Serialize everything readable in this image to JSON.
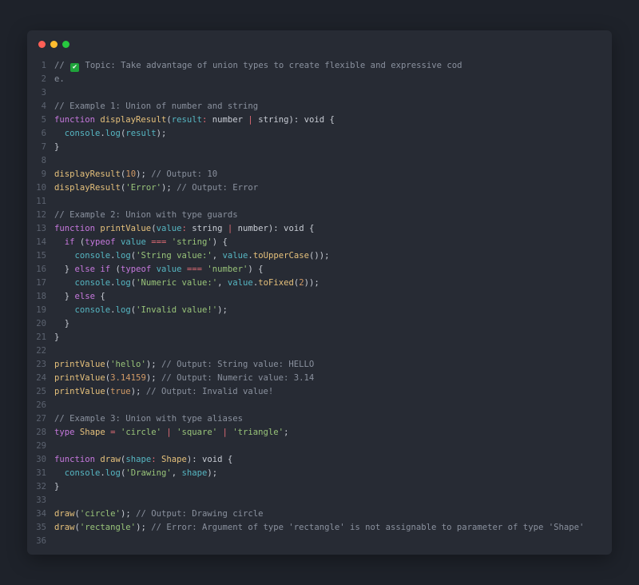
{
  "window": {
    "controls": [
      {
        "name": "close",
        "color": "#ff5f56"
      },
      {
        "name": "minimize",
        "color": "#ffbd2e"
      },
      {
        "name": "maximize",
        "color": "#27c93f"
      }
    ]
  },
  "code": {
    "lines": [
      {
        "n": "1",
        "tokens": [
          {
            "c": "comment",
            "t": "// "
          },
          {
            "c": "icon",
            "t": "check-icon"
          },
          {
            "c": "comment",
            "t": " Topic: Take advantage of union types to create flexible and expressive cod"
          }
        ]
      },
      {
        "n": "2",
        "tokens": [
          {
            "c": "comment",
            "t": "e."
          }
        ]
      },
      {
        "n": "3",
        "tokens": []
      },
      {
        "n": "4",
        "tokens": [
          {
            "c": "comment",
            "t": "// Example 1: Union of number and string"
          }
        ]
      },
      {
        "n": "5",
        "tokens": [
          {
            "c": "keyword",
            "t": "function "
          },
          {
            "c": "func",
            "t": "displayResult"
          },
          {
            "c": "plain",
            "t": "("
          },
          {
            "c": "param",
            "t": "result"
          },
          {
            "c": "op",
            "t": ": "
          },
          {
            "c": "plain",
            "t": "number "
          },
          {
            "c": "op",
            "t": "|"
          },
          {
            "c": "plain",
            "t": " string): void {"
          }
        ]
      },
      {
        "n": "6",
        "tokens": [
          {
            "c": "param",
            "t": "  console"
          },
          {
            "c": "plain",
            "t": "."
          },
          {
            "c": "param",
            "t": "log"
          },
          {
            "c": "plain",
            "t": "("
          },
          {
            "c": "param",
            "t": "result"
          },
          {
            "c": "plain",
            "t": ");"
          }
        ]
      },
      {
        "n": "7",
        "tokens": [
          {
            "c": "plain",
            "t": "}"
          }
        ]
      },
      {
        "n": "8",
        "tokens": []
      },
      {
        "n": "9",
        "tokens": [
          {
            "c": "func",
            "t": "displayResult"
          },
          {
            "c": "plain",
            "t": "("
          },
          {
            "c": "number",
            "t": "10"
          },
          {
            "c": "plain",
            "t": "); "
          },
          {
            "c": "comment",
            "t": "// Output: 10"
          }
        ]
      },
      {
        "n": "10",
        "tokens": [
          {
            "c": "func",
            "t": "displayResult"
          },
          {
            "c": "plain",
            "t": "("
          },
          {
            "c": "string",
            "t": "'Error'"
          },
          {
            "c": "plain",
            "t": "); "
          },
          {
            "c": "comment",
            "t": "// Output: Error"
          }
        ]
      },
      {
        "n": "11",
        "tokens": []
      },
      {
        "n": "12",
        "tokens": [
          {
            "c": "comment",
            "t": "// Example 2: Union with type guards"
          }
        ]
      },
      {
        "n": "13",
        "tokens": [
          {
            "c": "keyword",
            "t": "function "
          },
          {
            "c": "func",
            "t": "printValue"
          },
          {
            "c": "plain",
            "t": "("
          },
          {
            "c": "param",
            "t": "value"
          },
          {
            "c": "op",
            "t": ": "
          },
          {
            "c": "plain",
            "t": "string "
          },
          {
            "c": "op",
            "t": "|"
          },
          {
            "c": "plain",
            "t": " number): void {"
          }
        ]
      },
      {
        "n": "14",
        "tokens": [
          {
            "c": "keyword",
            "t": "  if "
          },
          {
            "c": "plain",
            "t": "("
          },
          {
            "c": "keyword",
            "t": "typeof "
          },
          {
            "c": "param",
            "t": "value "
          },
          {
            "c": "op",
            "t": "==="
          },
          {
            "c": "string",
            "t": " 'string'"
          },
          {
            "c": "plain",
            "t": ") {"
          }
        ]
      },
      {
        "n": "15",
        "tokens": [
          {
            "c": "param",
            "t": "    console"
          },
          {
            "c": "plain",
            "t": "."
          },
          {
            "c": "param",
            "t": "log"
          },
          {
            "c": "plain",
            "t": "("
          },
          {
            "c": "string",
            "t": "'String value:'"
          },
          {
            "c": "plain",
            "t": ", "
          },
          {
            "c": "param",
            "t": "value"
          },
          {
            "c": "plain",
            "t": "."
          },
          {
            "c": "func",
            "t": "toUpperCase"
          },
          {
            "c": "plain",
            "t": "());"
          }
        ]
      },
      {
        "n": "16",
        "tokens": [
          {
            "c": "plain",
            "t": "  } "
          },
          {
            "c": "keyword",
            "t": "else if "
          },
          {
            "c": "plain",
            "t": "("
          },
          {
            "c": "keyword",
            "t": "typeof "
          },
          {
            "c": "param",
            "t": "value "
          },
          {
            "c": "op",
            "t": "==="
          },
          {
            "c": "string",
            "t": " 'number'"
          },
          {
            "c": "plain",
            "t": ") {"
          }
        ]
      },
      {
        "n": "17",
        "tokens": [
          {
            "c": "param",
            "t": "    console"
          },
          {
            "c": "plain",
            "t": "."
          },
          {
            "c": "param",
            "t": "log"
          },
          {
            "c": "plain",
            "t": "("
          },
          {
            "c": "string",
            "t": "'Numeric value:'"
          },
          {
            "c": "plain",
            "t": ", "
          },
          {
            "c": "param",
            "t": "value"
          },
          {
            "c": "plain",
            "t": "."
          },
          {
            "c": "func",
            "t": "toFixed"
          },
          {
            "c": "plain",
            "t": "("
          },
          {
            "c": "number",
            "t": "2"
          },
          {
            "c": "plain",
            "t": "));"
          }
        ]
      },
      {
        "n": "18",
        "tokens": [
          {
            "c": "plain",
            "t": "  } "
          },
          {
            "c": "keyword",
            "t": "else"
          },
          {
            "c": "plain",
            "t": " {"
          }
        ]
      },
      {
        "n": "19",
        "tokens": [
          {
            "c": "param",
            "t": "    console"
          },
          {
            "c": "plain",
            "t": "."
          },
          {
            "c": "param",
            "t": "log"
          },
          {
            "c": "plain",
            "t": "("
          },
          {
            "c": "string",
            "t": "'Invalid value!'"
          },
          {
            "c": "plain",
            "t": ");"
          }
        ]
      },
      {
        "n": "20",
        "tokens": [
          {
            "c": "plain",
            "t": "  }"
          }
        ]
      },
      {
        "n": "21",
        "tokens": [
          {
            "c": "plain",
            "t": "}"
          }
        ]
      },
      {
        "n": "22",
        "tokens": []
      },
      {
        "n": "23",
        "tokens": [
          {
            "c": "func",
            "t": "printValue"
          },
          {
            "c": "plain",
            "t": "("
          },
          {
            "c": "string",
            "t": "'hello'"
          },
          {
            "c": "plain",
            "t": "); "
          },
          {
            "c": "comment",
            "t": "// Output: String value: HELLO"
          }
        ]
      },
      {
        "n": "24",
        "tokens": [
          {
            "c": "func",
            "t": "printValue"
          },
          {
            "c": "plain",
            "t": "("
          },
          {
            "c": "number",
            "t": "3.14159"
          },
          {
            "c": "plain",
            "t": "); "
          },
          {
            "c": "comment",
            "t": "// Output: Numeric value: 3.14"
          }
        ]
      },
      {
        "n": "25",
        "tokens": [
          {
            "c": "func",
            "t": "printValue"
          },
          {
            "c": "plain",
            "t": "("
          },
          {
            "c": "number",
            "t": "true"
          },
          {
            "c": "plain",
            "t": "); "
          },
          {
            "c": "comment",
            "t": "// Output: Invalid value!"
          }
        ]
      },
      {
        "n": "26",
        "tokens": []
      },
      {
        "n": "27",
        "tokens": [
          {
            "c": "comment",
            "t": "// Example 3: Union with type aliases"
          }
        ]
      },
      {
        "n": "28",
        "tokens": [
          {
            "c": "keyword",
            "t": "type "
          },
          {
            "c": "type",
            "t": "Shape "
          },
          {
            "c": "op",
            "t": "="
          },
          {
            "c": "string",
            "t": " 'circle' "
          },
          {
            "c": "op",
            "t": "|"
          },
          {
            "c": "string",
            "t": " 'square' "
          },
          {
            "c": "op",
            "t": "|"
          },
          {
            "c": "string",
            "t": " 'triangle'"
          },
          {
            "c": "plain",
            "t": ";"
          }
        ]
      },
      {
        "n": "29",
        "tokens": []
      },
      {
        "n": "30",
        "tokens": [
          {
            "c": "keyword",
            "t": "function "
          },
          {
            "c": "func",
            "t": "draw"
          },
          {
            "c": "plain",
            "t": "("
          },
          {
            "c": "param",
            "t": "shape"
          },
          {
            "c": "op",
            "t": ": "
          },
          {
            "c": "type",
            "t": "Shape"
          },
          {
            "c": "plain",
            "t": "): void {"
          }
        ]
      },
      {
        "n": "31",
        "tokens": [
          {
            "c": "param",
            "t": "  console"
          },
          {
            "c": "plain",
            "t": "."
          },
          {
            "c": "param",
            "t": "log"
          },
          {
            "c": "plain",
            "t": "("
          },
          {
            "c": "string",
            "t": "'Drawing'"
          },
          {
            "c": "plain",
            "t": ", "
          },
          {
            "c": "param",
            "t": "shape"
          },
          {
            "c": "plain",
            "t": ");"
          }
        ]
      },
      {
        "n": "32",
        "tokens": [
          {
            "c": "plain",
            "t": "}"
          }
        ]
      },
      {
        "n": "33",
        "tokens": []
      },
      {
        "n": "34",
        "tokens": [
          {
            "c": "func",
            "t": "draw"
          },
          {
            "c": "plain",
            "t": "("
          },
          {
            "c": "string",
            "t": "'circle'"
          },
          {
            "c": "plain",
            "t": "); "
          },
          {
            "c": "comment",
            "t": "// Output: Drawing circle"
          }
        ]
      },
      {
        "n": "35",
        "tokens": [
          {
            "c": "func",
            "t": "draw"
          },
          {
            "c": "plain",
            "t": "("
          },
          {
            "c": "string",
            "t": "'rectangle'"
          },
          {
            "c": "plain",
            "t": "); "
          },
          {
            "c": "comment",
            "t": "// Error: Argument of type 'rectangle' is not assignable to parameter of type 'Shape'"
          }
        ]
      },
      {
        "n": "36",
        "tokens": []
      }
    ]
  }
}
